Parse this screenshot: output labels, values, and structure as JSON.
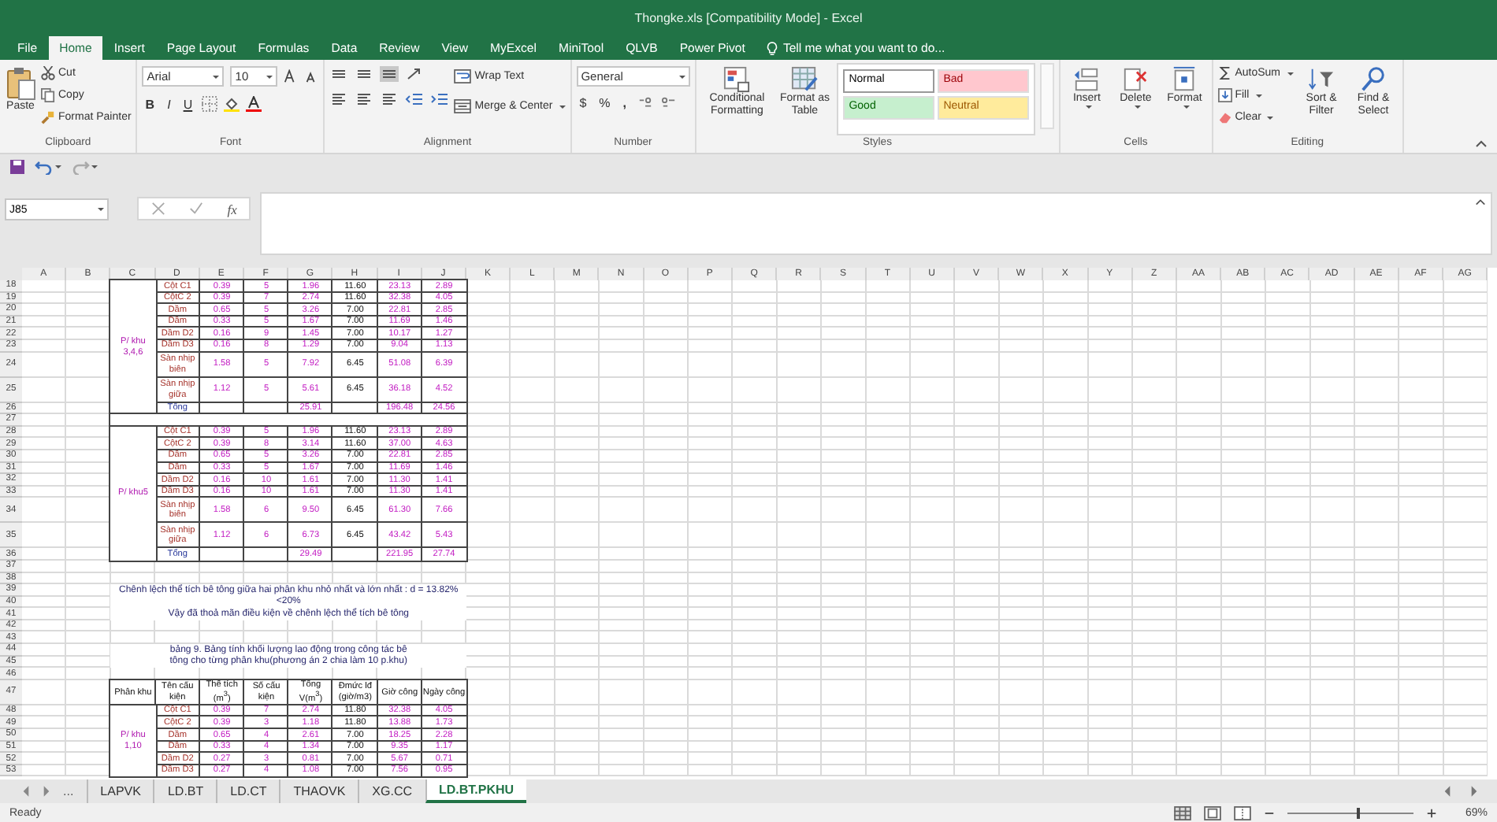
{
  "window": {
    "title": "Thongke.xls  [Compatibility Mode] - Excel"
  },
  "menu_tabs": [
    {
      "label": "File",
      "selected": false
    },
    {
      "label": "Home",
      "selected": true
    },
    {
      "label": "Insert",
      "selected": false
    },
    {
      "label": "Page Layout",
      "selected": false
    },
    {
      "label": "Formulas",
      "selected": false
    },
    {
      "label": "Data",
      "selected": false
    },
    {
      "label": "Review",
      "selected": false
    },
    {
      "label": "View",
      "selected": false
    },
    {
      "label": "MyExcel",
      "selected": false
    },
    {
      "label": "MiniTool",
      "selected": false
    },
    {
      "label": "QLVB",
      "selected": false
    },
    {
      "label": "Power Pivot",
      "selected": false
    }
  ],
  "tell_me": {
    "placeholder": "Tell me what you want to do..."
  },
  "ribbon": {
    "clipboard": {
      "paste": "Paste",
      "cut": "Cut",
      "copy": "Copy",
      "format_painter": "Format Painter",
      "label": "Clipboard"
    },
    "font": {
      "name": "Arial",
      "size": "10",
      "bold": "B",
      "italic": "I",
      "underline": "U",
      "label": "Font"
    },
    "alignment": {
      "wrap_text": "Wrap Text",
      "merge_center": "Merge & Center",
      "label": "Alignment"
    },
    "number": {
      "format": "General",
      "currency": "$",
      "percent": "%",
      "comma": ",",
      "label": "Number"
    },
    "styles": {
      "conditional_formatting": "Conditional Formatting",
      "format_as_table": "Format as Table",
      "label": "Styles",
      "cell_styles": [
        {
          "label": "Normal",
          "color": "#ffffff"
        },
        {
          "label": "Bad",
          "color": "#ffc7ce"
        },
        {
          "label": "Good",
          "color": "#c6efce"
        },
        {
          "label": "Neutral",
          "color": "#ffeb9c"
        }
      ]
    },
    "cells": {
      "insert": "Insert",
      "delete": "Delete",
      "format": "Format",
      "label": "Cells"
    },
    "editing": {
      "autosum": "AutoSum",
      "fill": "Fill",
      "clear": "Clear",
      "sort_filter": "Sort & Filter",
      "find_select": "Find & Select",
      "label": "Editing"
    }
  },
  "formula_bar": {
    "name_box": "J85",
    "fx": "fx"
  },
  "sheet": {
    "columns": [
      "A",
      "B",
      "C",
      "D",
      "E",
      "F",
      "G",
      "H",
      "I",
      "J",
      "K",
      "L",
      "M",
      "N",
      "O",
      "P",
      "Q",
      "R",
      "S",
      "T",
      "U",
      "V",
      "W",
      "X",
      "Y",
      "Z",
      "AA",
      "AB",
      "AC",
      "AD",
      "AE",
      "AF",
      "AG"
    ],
    "sections": [
      {
        "kind": "group",
        "zone": "P/ khu 3,4,6",
        "rows": [
          {
            "n": "18",
            "tall": false,
            "cells": [
              {
                "kind": "name",
                "text": "Cột C1"
              },
              {
                "kind": "value",
                "text": "0.39"
              },
              {
                "kind": "value",
                "text": "5"
              },
              {
                "kind": "value",
                "text": "1.96"
              },
              {
                "kind": "norm",
                "text": "11.60"
              },
              {
                "kind": "value",
                "text": "23.13"
              },
              {
                "kind": "value",
                "text": "2.89"
              }
            ]
          },
          {
            "n": "19",
            "tall": false,
            "cells": [
              {
                "kind": "name",
                "text": "CộtC 2"
              },
              {
                "kind": "value",
                "text": "0.39"
              },
              {
                "kind": "value",
                "text": "7"
              },
              {
                "kind": "value",
                "text": "2.74"
              },
              {
                "kind": "norm",
                "text": "11.60"
              },
              {
                "kind": "value",
                "text": "32.38"
              },
              {
                "kind": "value",
                "text": "4.05"
              }
            ]
          },
          {
            "n": "20",
            "tall": false,
            "cells": [
              {
                "kind": "name",
                "text": "Dầm"
              },
              {
                "kind": "value",
                "text": "0.65"
              },
              {
                "kind": "value",
                "text": "5"
              },
              {
                "kind": "value",
                "text": "3.26"
              },
              {
                "kind": "norm",
                "text": "7.00"
              },
              {
                "kind": "value",
                "text": "22.81"
              },
              {
                "kind": "value",
                "text": "2.85"
              }
            ]
          },
          {
            "n": "21",
            "tall": false,
            "cells": [
              {
                "kind": "name",
                "text": "Dầm"
              },
              {
                "kind": "value",
                "text": "0.33"
              },
              {
                "kind": "value",
                "text": "5"
              },
              {
                "kind": "value",
                "text": "1.67"
              },
              {
                "kind": "norm",
                "text": "7.00"
              },
              {
                "kind": "value",
                "text": "11.69"
              },
              {
                "kind": "value",
                "text": "1.46"
              }
            ]
          },
          {
            "n": "22",
            "tall": false,
            "cells": [
              {
                "kind": "name",
                "text": "Dầm D2"
              },
              {
                "kind": "value",
                "text": "0.16"
              },
              {
                "kind": "value",
                "text": "9"
              },
              {
                "kind": "value",
                "text": "1.45"
              },
              {
                "kind": "norm",
                "text": "7.00"
              },
              {
                "kind": "value",
                "text": "10.17"
              },
              {
                "kind": "value",
                "text": "1.27"
              }
            ]
          },
          {
            "n": "23",
            "tall": false,
            "cells": [
              {
                "kind": "name",
                "text": "Dầm D3"
              },
              {
                "kind": "value",
                "text": "0.16"
              },
              {
                "kind": "value",
                "text": "8"
              },
              {
                "kind": "value",
                "text": "1.29"
              },
              {
                "kind": "norm",
                "text": "7.00"
              },
              {
                "kind": "value",
                "text": "9.04"
              },
              {
                "kind": "value",
                "text": "1.13"
              }
            ]
          },
          {
            "n": "24",
            "tall": true,
            "cells": [
              {
                "kind": "name",
                "text": "Sàn nhịp biên"
              },
              {
                "kind": "value",
                "text": "1.58"
              },
              {
                "kind": "value",
                "text": "5"
              },
              {
                "kind": "value",
                "text": "7.92"
              },
              {
                "kind": "norm",
                "text": "6.45"
              },
              {
                "kind": "value",
                "text": "51.08"
              },
              {
                "kind": "value",
                "text": "6.39"
              }
            ]
          },
          {
            "n": "25",
            "tall": true,
            "cells": [
              {
                "kind": "name",
                "text": "Sàn nhịp giữa"
              },
              {
                "kind": "value",
                "text": "1.12"
              },
              {
                "kind": "value",
                "text": "5"
              },
              {
                "kind": "value",
                "text": "5.61"
              },
              {
                "kind": "norm",
                "text": "6.45"
              },
              {
                "kind": "value",
                "text": "36.18"
              },
              {
                "kind": "value",
                "text": "4.52"
              }
            ]
          },
          {
            "n": "26",
            "tall": false,
            "cells": [
              {
                "kind": "total",
                "text": "Tổng"
              },
              {
                "kind": "empty"
              },
              {
                "kind": "empty"
              },
              {
                "kind": "value",
                "text": "25.91"
              },
              {
                "kind": "empty"
              },
              {
                "kind": "value",
                "text": "196.48"
              },
              {
                "kind": "value",
                "text": "24.56"
              }
            ]
          }
        ]
      },
      {
        "kind": "bar",
        "rows": [
          {
            "n": "27",
            "tall": false
          }
        ]
      },
      {
        "kind": "group",
        "zone": "P/ khu5",
        "rows": [
          {
            "n": "28",
            "tall": false,
            "cells": [
              {
                "kind": "name",
                "text": "Cột C1"
              },
              {
                "kind": "value",
                "text": "0.39"
              },
              {
                "kind": "value",
                "text": "5"
              },
              {
                "kind": "value",
                "text": "1.96"
              },
              {
                "kind": "norm",
                "text": "11.60"
              },
              {
                "kind": "value",
                "text": "23.13"
              },
              {
                "kind": "value",
                "text": "2.89"
              }
            ]
          },
          {
            "n": "29",
            "tall": false,
            "cells": [
              {
                "kind": "name",
                "text": "CộtC 2"
              },
              {
                "kind": "value",
                "text": "0.39"
              },
              {
                "kind": "value",
                "text": "8"
              },
              {
                "kind": "value",
                "text": "3.14"
              },
              {
                "kind": "norm",
                "text": "11.60"
              },
              {
                "kind": "value",
                "text": "37.00"
              },
              {
                "kind": "value",
                "text": "4.63"
              }
            ]
          },
          {
            "n": "30",
            "tall": false,
            "cells": [
              {
                "kind": "name",
                "text": "Dầm"
              },
              {
                "kind": "value",
                "text": "0.65"
              },
              {
                "kind": "value",
                "text": "5"
              },
              {
                "kind": "value",
                "text": "3.26"
              },
              {
                "kind": "norm",
                "text": "7.00"
              },
              {
                "kind": "value",
                "text": "22.81"
              },
              {
                "kind": "value",
                "text": "2.85"
              }
            ]
          },
          {
            "n": "31",
            "tall": false,
            "cells": [
              {
                "kind": "name",
                "text": "Dầm"
              },
              {
                "kind": "value",
                "text": "0.33"
              },
              {
                "kind": "value",
                "text": "5"
              },
              {
                "kind": "value",
                "text": "1.67"
              },
              {
                "kind": "norm",
                "text": "7.00"
              },
              {
                "kind": "value",
                "text": "11.69"
              },
              {
                "kind": "value",
                "text": "1.46"
              }
            ]
          },
          {
            "n": "32",
            "tall": false,
            "cells": [
              {
                "kind": "name",
                "text": "Dầm D2"
              },
              {
                "kind": "value",
                "text": "0.16"
              },
              {
                "kind": "value",
                "text": "10"
              },
              {
                "kind": "value",
                "text": "1.61"
              },
              {
                "kind": "norm",
                "text": "7.00"
              },
              {
                "kind": "value",
                "text": "11.30"
              },
              {
                "kind": "value",
                "text": "1.41"
              }
            ]
          },
          {
            "n": "33",
            "tall": false,
            "cells": [
              {
                "kind": "name",
                "text": "Dầm D3"
              },
              {
                "kind": "value",
                "text": "0.16"
              },
              {
                "kind": "value",
                "text": "10"
              },
              {
                "kind": "value",
                "text": "1.61"
              },
              {
                "kind": "norm",
                "text": "7.00"
              },
              {
                "kind": "value",
                "text": "11.30"
              },
              {
                "kind": "value",
                "text": "1.41"
              }
            ]
          },
          {
            "n": "34",
            "tall": true,
            "cells": [
              {
                "kind": "name",
                "text": "Sàn nhịp biên"
              },
              {
                "kind": "value",
                "text": "1.58"
              },
              {
                "kind": "value",
                "text": "6"
              },
              {
                "kind": "value",
                "text": "9.50"
              },
              {
                "kind": "norm",
                "text": "6.45"
              },
              {
                "kind": "value",
                "text": "61.30"
              },
              {
                "kind": "value",
                "text": "7.66"
              }
            ]
          },
          {
            "n": "35",
            "tall": true,
            "cells": [
              {
                "kind": "name",
                "text": "Sàn nhịp giữa"
              },
              {
                "kind": "value",
                "text": "1.12"
              },
              {
                "kind": "value",
                "text": "6"
              },
              {
                "kind": "value",
                "text": "6.73"
              },
              {
                "kind": "norm",
                "text": "6.45"
              },
              {
                "kind": "value",
                "text": "43.42"
              },
              {
                "kind": "value",
                "text": "5.43"
              }
            ]
          },
          {
            "n": "36",
            "tall": false,
            "cells": [
              {
                "kind": "total",
                "text": "Tổng"
              },
              {
                "kind": "empty"
              },
              {
                "kind": "empty"
              },
              {
                "kind": "value",
                "text": "29.49"
              },
              {
                "kind": "empty"
              },
              {
                "kind": "value",
                "text": "221.95"
              },
              {
                "kind": "value",
                "text": "27.74"
              }
            ]
          }
        ]
      },
      {
        "kind": "empty",
        "rows": [
          {
            "n": "37",
            "tall": false
          },
          {
            "n": "38",
            "tall": false
          }
        ]
      },
      {
        "kind": "note",
        "rows": [
          {
            "n": "39",
            "tall": false,
            "text": "Chênh lệch thể tích bê tông giữa hai phân khu nhỏ nhất và lớn nhất : d = 13.82%"
          },
          {
            "n": "40",
            "tall": false,
            "text": "<20%"
          },
          {
            "n": "41",
            "tall": false,
            "text": "Vậy đã thoả mãn điều kiện về chênh lệch thể tích bê tông"
          }
        ]
      },
      {
        "kind": "empty",
        "rows": [
          {
            "n": "42",
            "tall": false
          },
          {
            "n": "43",
            "tall": false
          }
        ]
      },
      {
        "kind": "note",
        "rows": [
          {
            "n": "44",
            "tall": false,
            "text": "bảng 9. Bảng tính khối lượng lao động trong công tác bê"
          },
          {
            "n": "45",
            "tall": false,
            "text": "tông cho từng phân khu(phương án 2 chia làm 10 p.khu)"
          }
        ]
      },
      {
        "kind": "empty",
        "rows": [
          {
            "n": "46",
            "tall": false
          }
        ]
      },
      {
        "kind": "header",
        "rows": [
          {
            "n": "47",
            "tall": true,
            "cells": [
              {
                "kind": "header",
                "text": "Phân khu"
              },
              {
                "kind": "header",
                "text": "Tên cấu kiện"
              },
              {
                "kind": "header",
                "text": "Thể tích (m$^{3}$)"
              },
              {
                "kind": "header",
                "text": "Số cấu kiện"
              },
              {
                "kind": "header",
                "text": "Tổng V(m$^{3}$)"
              },
              {
                "kind": "header",
                "text": "Đmức lđ (giờ/m3)"
              },
              {
                "kind": "header",
                "text": "Giờ công"
              },
              {
                "kind": "header",
                "text": "Ngày công"
              }
            ]
          }
        ]
      },
      {
        "kind": "group",
        "zone": "P/ khu 1,10",
        "rows": [
          {
            "n": "48",
            "tall": false,
            "cells": [
              {
                "kind": "name",
                "text": "Cột C1"
              },
              {
                "kind": "value",
                "text": "0.39"
              },
              {
                "kind": "value",
                "text": "7"
              },
              {
                "kind": "value",
                "text": "2.74"
              },
              {
                "kind": "norm",
                "text": "11.80"
              },
              {
                "kind": "value",
                "text": "32.38"
              },
              {
                "kind": "value",
                "text": "4.05"
              }
            ]
          },
          {
            "n": "49",
            "tall": false,
            "cells": [
              {
                "kind": "name",
                "text": "CộtC 2"
              },
              {
                "kind": "value",
                "text": "0.39"
              },
              {
                "kind": "value",
                "text": "3"
              },
              {
                "kind": "value",
                "text": "1.18"
              },
              {
                "kind": "norm",
                "text": "11.80"
              },
              {
                "kind": "value",
                "text": "13.88"
              },
              {
                "kind": "value",
                "text": "1.73"
              }
            ]
          },
          {
            "n": "50",
            "tall": false,
            "cells": [
              {
                "kind": "name",
                "text": "Dầm"
              },
              {
                "kind": "value",
                "text": "0.65"
              },
              {
                "kind": "value",
                "text": "4"
              },
              {
                "kind": "value",
                "text": "2.61"
              },
              {
                "kind": "norm",
                "text": "7.00"
              },
              {
                "kind": "value",
                "text": "18.25"
              },
              {
                "kind": "value",
                "text": "2.28"
              }
            ]
          },
          {
            "n": "51",
            "tall": false,
            "cells": [
              {
                "kind": "name",
                "text": "Dầm"
              },
              {
                "kind": "value",
                "text": "0.33"
              },
              {
                "kind": "value",
                "text": "4"
              },
              {
                "kind": "value",
                "text": "1.34"
              },
              {
                "kind": "norm",
                "text": "7.00"
              },
              {
                "kind": "value",
                "text": "9.35"
              },
              {
                "kind": "value",
                "text": "1.17"
              }
            ]
          },
          {
            "n": "52",
            "tall": false,
            "cells": [
              {
                "kind": "name",
                "text": "Dầm D2"
              },
              {
                "kind": "value",
                "text": "0.27"
              },
              {
                "kind": "value",
                "text": "3"
              },
              {
                "kind": "value",
                "text": "0.81"
              },
              {
                "kind": "norm",
                "text": "7.00"
              },
              {
                "kind": "value",
                "text": "5.67"
              },
              {
                "kind": "value",
                "text": "0.71"
              }
            ]
          },
          {
            "n": "53",
            "tall": false,
            "cells": [
              {
                "kind": "name",
                "text": "Dầm D3"
              },
              {
                "kind": "value",
                "text": "0.27"
              },
              {
                "kind": "value",
                "text": "4"
              },
              {
                "kind": "value",
                "text": "1.08"
              },
              {
                "kind": "norm",
                "text": "7.00"
              },
              {
                "kind": "value",
                "text": "7.56"
              },
              {
                "kind": "value",
                "text": "0.95"
              }
            ]
          }
        ]
      }
    ]
  },
  "sheet_nav": {
    "more": "..."
  },
  "sheet_tabs": [
    {
      "label": "LAPVK",
      "selected": false
    },
    {
      "label": "LD.BT",
      "selected": false
    },
    {
      "label": "LD.CT",
      "selected": false
    },
    {
      "label": "THAOVK",
      "selected": false
    },
    {
      "label": "XG.CC",
      "selected": false
    },
    {
      "label": "LD.BT.PKHU",
      "selected": true
    }
  ],
  "status_bar": {
    "status": "Ready",
    "zoom_slider": {
      "level": 0.55
    },
    "zoom": "69%"
  }
}
